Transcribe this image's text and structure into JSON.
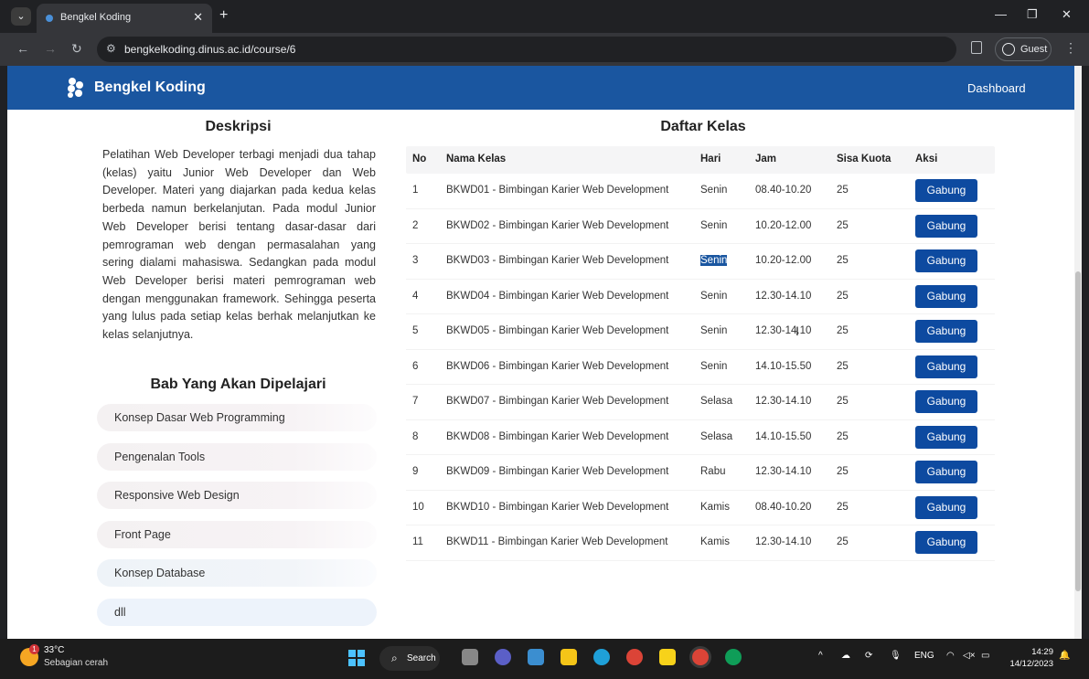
{
  "browser": {
    "tab_title": "Bengkel Koding",
    "url": "bengkelkoding.dinus.ac.id/course/6",
    "profile_label": "Guest"
  },
  "nav": {
    "brand": "Bengkel Koding",
    "dashboard": "Dashboard"
  },
  "deskripsi": {
    "title": "Deskripsi",
    "text": "Pelatihan Web Developer terbagi menjadi dua tahap (kelas) yaitu Junior Web Developer dan Web Developer. Materi yang diajarkan pada kedua kelas berbeda namun berkelanjutan. Pada modul Junior Web Developer berisi tentang dasar-dasar dari pemrograman web dengan permasalahan yang sering dialami mahasiswa. Sedangkan pada modul Web Developer berisi materi pemrograman web dengan menggunakan framework. Sehingga peserta yang lulus pada setiap kelas berhak melanjutkan ke kelas selanjutnya."
  },
  "bab": {
    "title": "Bab Yang Akan Dipelajari",
    "items": [
      "Konsep Dasar Web Programming",
      "Pengenalan Tools",
      "Responsive Web Design",
      "Front Page",
      "Konsep Database",
      "dll"
    ]
  },
  "kelas": {
    "title": "Daftar Kelas",
    "headers": {
      "no": "No",
      "nama": "Nama Kelas",
      "hari": "Hari",
      "jam": "Jam",
      "kuota": "Sisa Kuota",
      "aksi": "Aksi"
    },
    "button_label": "Gabung",
    "rows": [
      {
        "no": "1",
        "nama": "BKWD01 - Bimbingan Karier Web Development",
        "hari": "Senin",
        "jam": "08.40-10.20",
        "kuota": "25"
      },
      {
        "no": "2",
        "nama": "BKWD02 - Bimbingan Karier Web Development",
        "hari": "Senin",
        "jam": "10.20-12.00",
        "kuota": "25"
      },
      {
        "no": "3",
        "nama": "BKWD03 - Bimbingan Karier Web Development",
        "hari": "Senin",
        "jam": "10.20-12.00",
        "kuota": "25"
      },
      {
        "no": "4",
        "nama": "BKWD04 - Bimbingan Karier Web Development",
        "hari": "Senin",
        "jam": "12.30-14.10",
        "kuota": "25"
      },
      {
        "no": "5",
        "nama": "BKWD05 - Bimbingan Karier Web Development",
        "hari": "Senin",
        "jam": "12.30-14.10",
        "kuota": "25"
      },
      {
        "no": "6",
        "nama": "BKWD06 - Bimbingan Karier Web Development",
        "hari": "Senin",
        "jam": "14.10-15.50",
        "kuota": "25"
      },
      {
        "no": "7",
        "nama": "BKWD07 - Bimbingan Karier Web Development",
        "hari": "Selasa",
        "jam": "12.30-14.10",
        "kuota": "25"
      },
      {
        "no": "8",
        "nama": "BKWD08 - Bimbingan Karier Web Development",
        "hari": "Selasa",
        "jam": "14.10-15.50",
        "kuota": "25"
      },
      {
        "no": "9",
        "nama": "BKWD09 - Bimbingan Karier Web Development",
        "hari": "Rabu",
        "jam": "12.30-14.10",
        "kuota": "25"
      },
      {
        "no": "10",
        "nama": "BKWD10 - Bimbingan Karier Web Development",
        "hari": "Kamis",
        "jam": "08.40-10.20",
        "kuota": "25"
      },
      {
        "no": "11",
        "nama": "BKWD11 - Bimbingan Karier Web Development",
        "hari": "Kamis",
        "jam": "12.30-14.10",
        "kuota": "25"
      }
    ]
  },
  "taskbar": {
    "weather_temp": "33°C",
    "weather_desc": "Sebagian cerah",
    "weather_badge": "1",
    "search_label": "Search",
    "lang": "ENG",
    "time": "14:29",
    "date": "14/12/2023"
  },
  "colors": {
    "navbar": "#1a56a0",
    "button": "#0d4aa0"
  }
}
